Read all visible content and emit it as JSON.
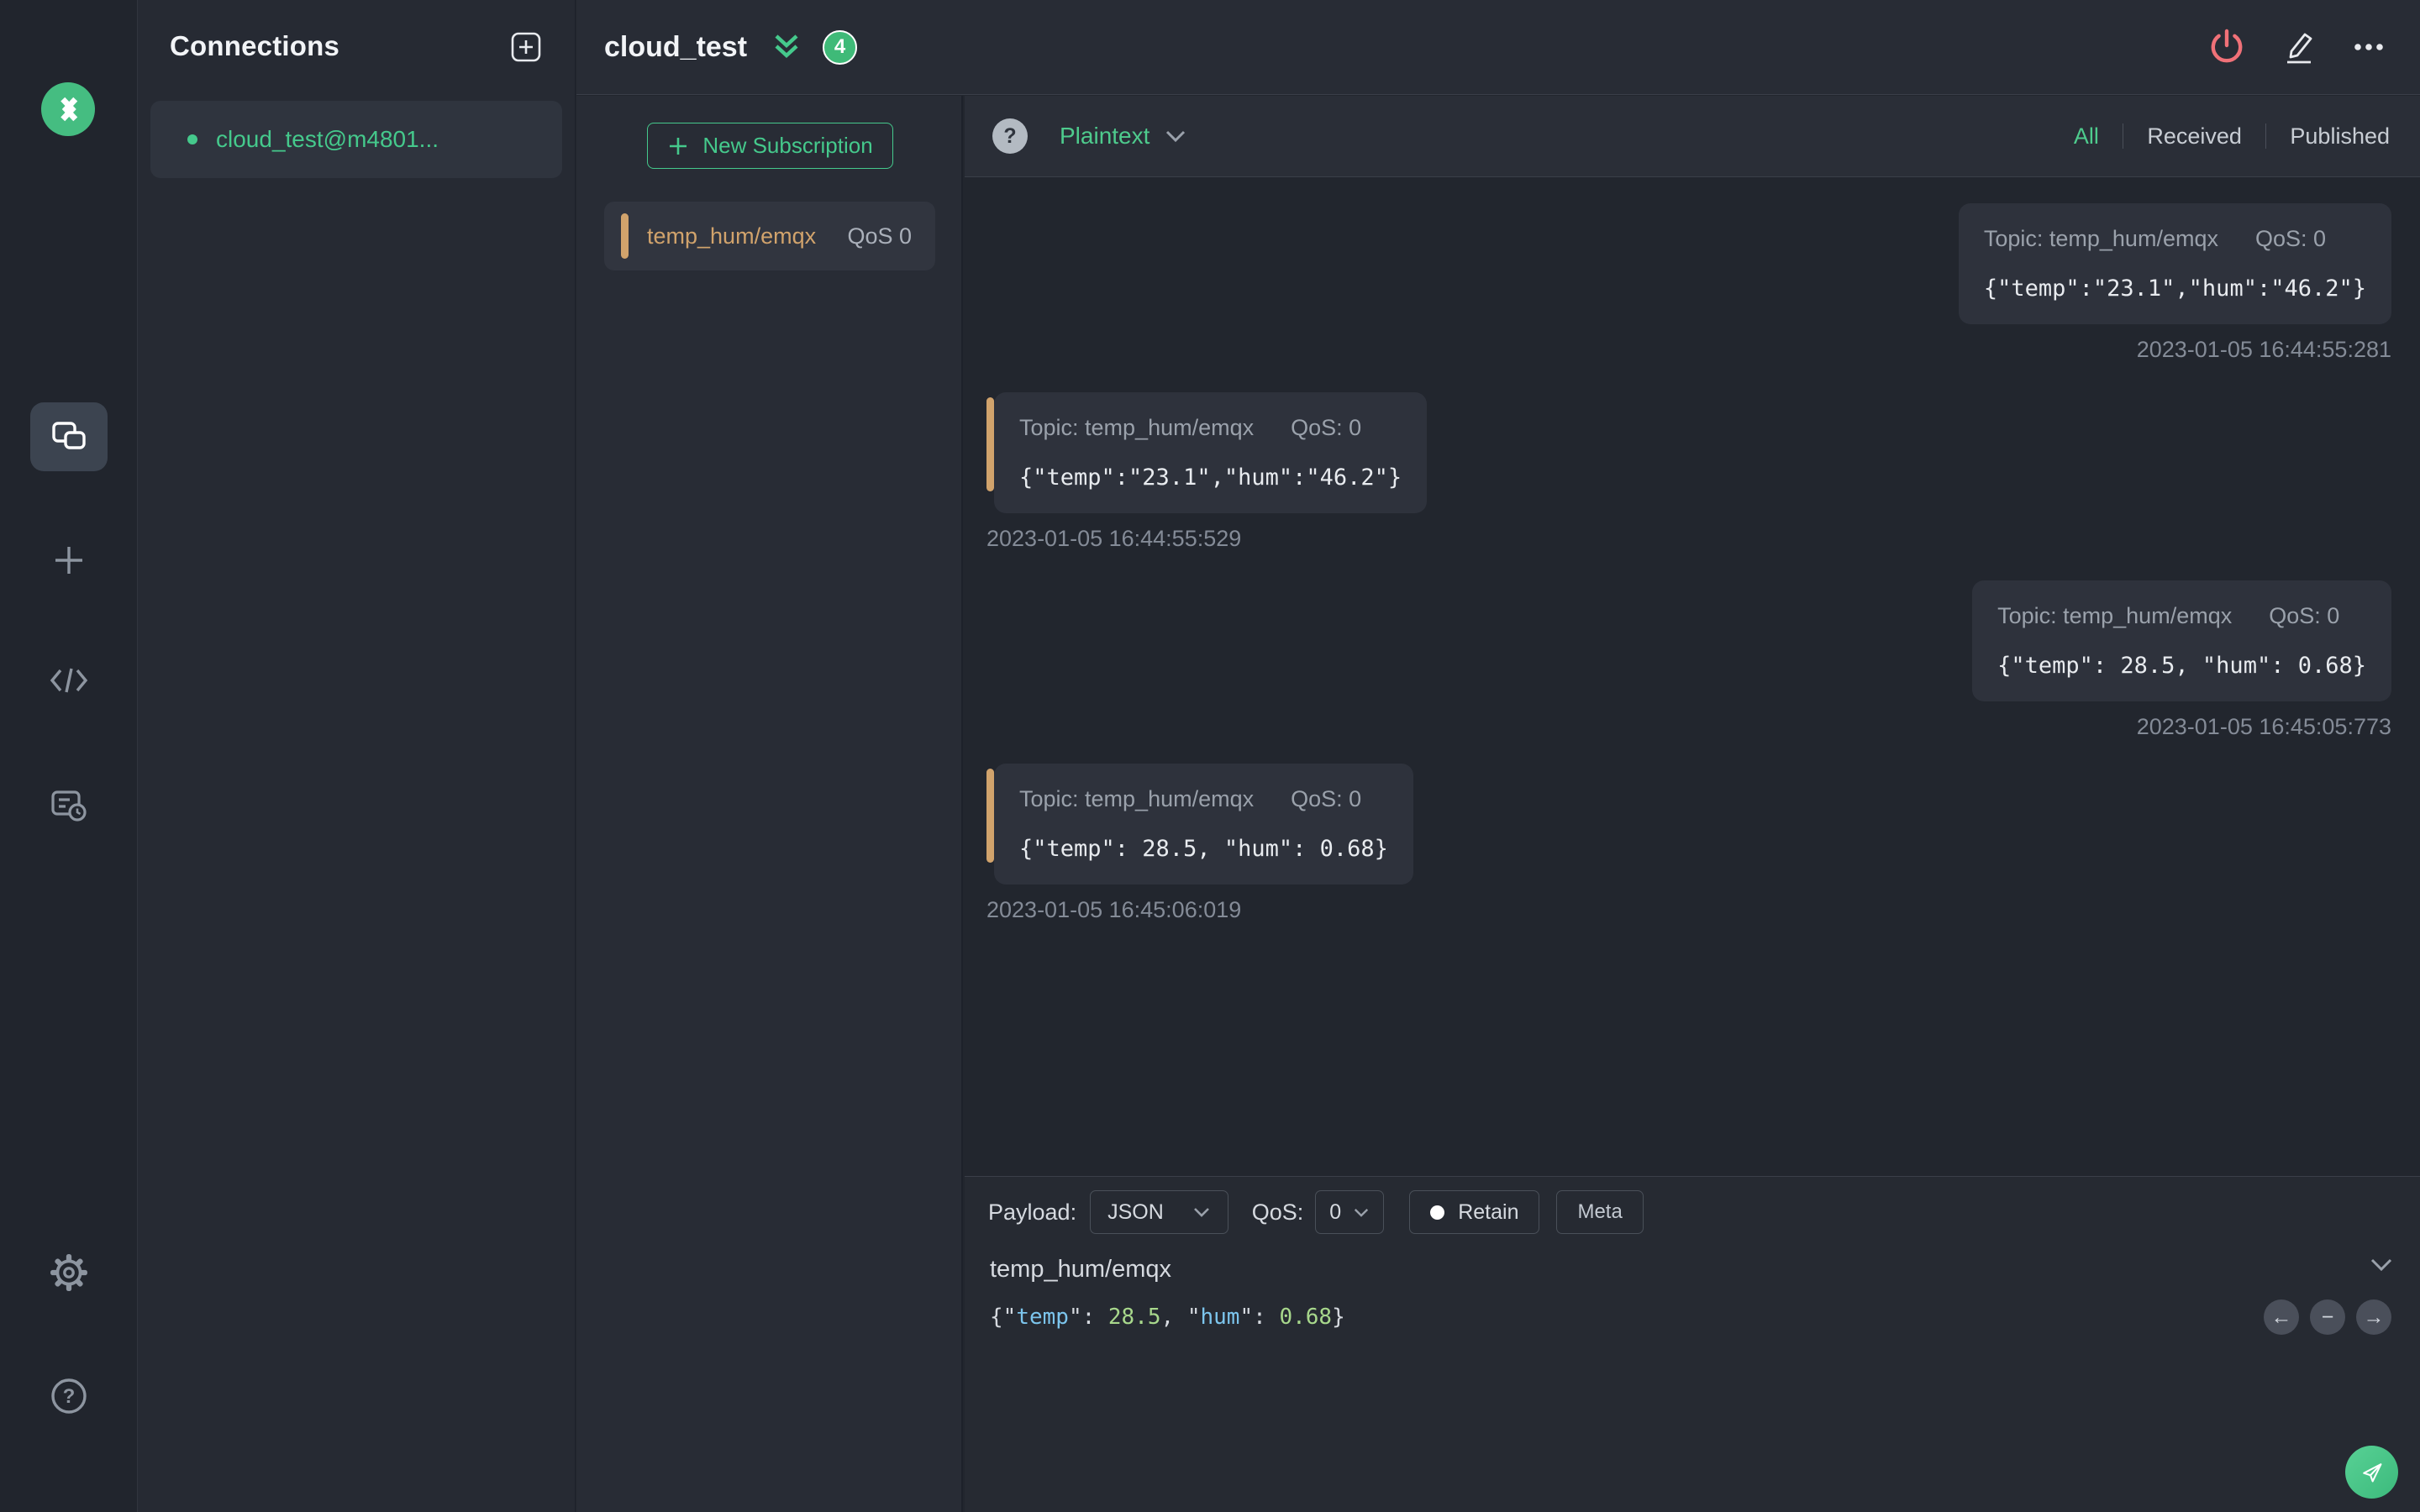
{
  "colors": {
    "accent_green": "#45c98c",
    "badge_green": "#3fba78",
    "subscription_tan": "#d1a36c",
    "danger_red": "#f07178"
  },
  "sidebar": {
    "title": "Connections",
    "connection": {
      "name": "cloud_test@m4801..."
    }
  },
  "topbar": {
    "title": "cloud_test",
    "badge": "4"
  },
  "subscriptions": {
    "new_button": "New Subscription",
    "item": {
      "topic": "temp_hum/emqx",
      "qos": "QoS 0"
    }
  },
  "msg_toolbar": {
    "help": "?",
    "format": "Plaintext",
    "tabs": {
      "all": "All",
      "received": "Received",
      "published": "Published"
    }
  },
  "messages": [
    {
      "direction": "published",
      "topic": "Topic: temp_hum/emqx",
      "qos": "QoS: 0",
      "payload": "{\"temp\":\"23.1\",\"hum\":\"46.2\"}",
      "time": "2023-01-05 16:44:55:281"
    },
    {
      "direction": "received",
      "topic": "Topic: temp_hum/emqx",
      "qos": "QoS: 0",
      "payload": "{\"temp\":\"23.1\",\"hum\":\"46.2\"}",
      "time": "2023-01-05 16:44:55:529"
    },
    {
      "direction": "published",
      "topic": "Topic: temp_hum/emqx",
      "qos": "QoS: 0",
      "payload": "{\"temp\": 28.5, \"hum\": 0.68}",
      "time": "2023-01-05 16:45:05:773"
    },
    {
      "direction": "received",
      "topic": "Topic: temp_hum/emqx",
      "qos": "QoS: 0",
      "payload": "{\"temp\": 28.5, \"hum\": 0.68}",
      "time": "2023-01-05 16:45:06:019"
    }
  ],
  "publish": {
    "payload_label": "Payload:",
    "payload_type": "JSON",
    "qos_label": "QoS:",
    "qos_value": "0",
    "retain_label": "Retain",
    "meta_label": "Meta",
    "topic": "temp_hum/emqx",
    "editor_tokens": [
      {
        "t": "{\"",
        "c": "p"
      },
      {
        "t": "temp",
        "c": "k"
      },
      {
        "t": "\": ",
        "c": "p"
      },
      {
        "t": "28.5",
        "c": "n"
      },
      {
        "t": ", \"",
        "c": "p"
      },
      {
        "t": "hum",
        "c": "k"
      },
      {
        "t": "\": ",
        "c": "p"
      },
      {
        "t": "0.68",
        "c": "n"
      },
      {
        "t": "}",
        "c": "p"
      }
    ],
    "history": {
      "prev": "←",
      "collapse": "−",
      "next": "→"
    }
  }
}
